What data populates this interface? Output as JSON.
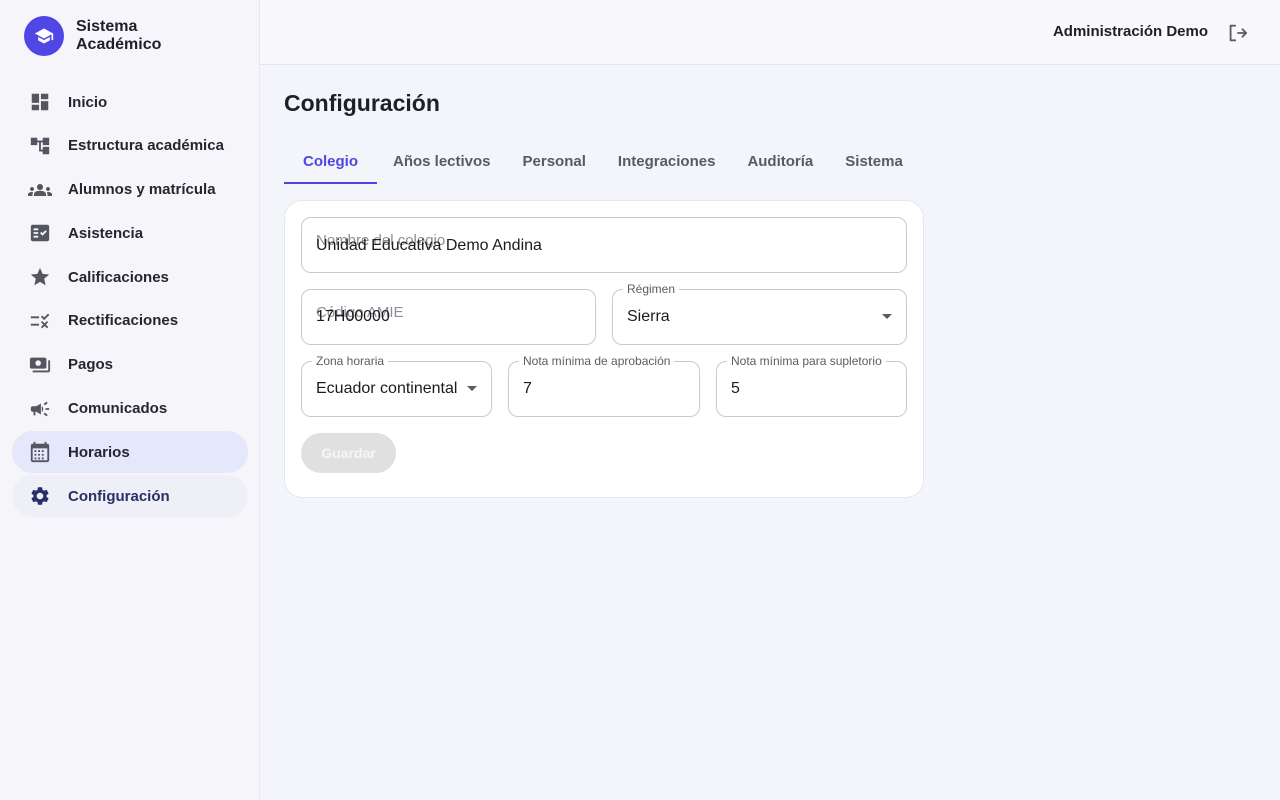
{
  "brand": {
    "line1": "Sistema",
    "line2": "Académico",
    "logo_icon": "graduation-cap-icon",
    "accent": "#4f46e5"
  },
  "sidebar": {
    "items": [
      {
        "label": "Inicio",
        "icon": "dashboard-icon"
      },
      {
        "label": "Estructura académica",
        "icon": "account-tree-icon"
      },
      {
        "label": "Alumnos y matrícula",
        "icon": "groups-icon"
      },
      {
        "label": "Asistencia",
        "icon": "fact-check-icon"
      },
      {
        "label": "Calificaciones",
        "icon": "star-icon"
      },
      {
        "label": "Rectificaciones",
        "icon": "rule-icon"
      },
      {
        "label": "Pagos",
        "icon": "payments-icon"
      },
      {
        "label": "Comunicados",
        "icon": "campaign-icon"
      },
      {
        "label": "Horarios",
        "icon": "calendar-icon"
      },
      {
        "label": "Configuración",
        "icon": "gear-icon"
      }
    ],
    "hovered": "Horarios",
    "active": "Configuración"
  },
  "header": {
    "user_name": "Administración Demo",
    "logout_icon": "logout-icon"
  },
  "main": {
    "title": "Configuración",
    "tabs": [
      {
        "label": "Colegio",
        "active": true
      },
      {
        "label": "Años lectivos",
        "active": false
      },
      {
        "label": "Personal",
        "active": false
      },
      {
        "label": "Integraciones",
        "active": false
      },
      {
        "label": "Auditoría",
        "active": false
      },
      {
        "label": "Sistema",
        "active": false
      }
    ]
  },
  "form": {
    "school_name": {
      "placeholder": "Nombre del colegio",
      "value": "Unidad Educativa Demo Andina"
    },
    "amie_code": {
      "placeholder": "Código AMIE",
      "value": "17H00000"
    },
    "regime": {
      "label": "Régimen",
      "value": "Sierra"
    },
    "timezone": {
      "label": "Zona horaria",
      "value": "Ecuador continental"
    },
    "min_pass": {
      "label": "Nota mínima de aprobación",
      "value": "7"
    },
    "min_supp": {
      "label": "Nota mínima para supletorio",
      "value": "5"
    },
    "save_label": "Guardar"
  }
}
